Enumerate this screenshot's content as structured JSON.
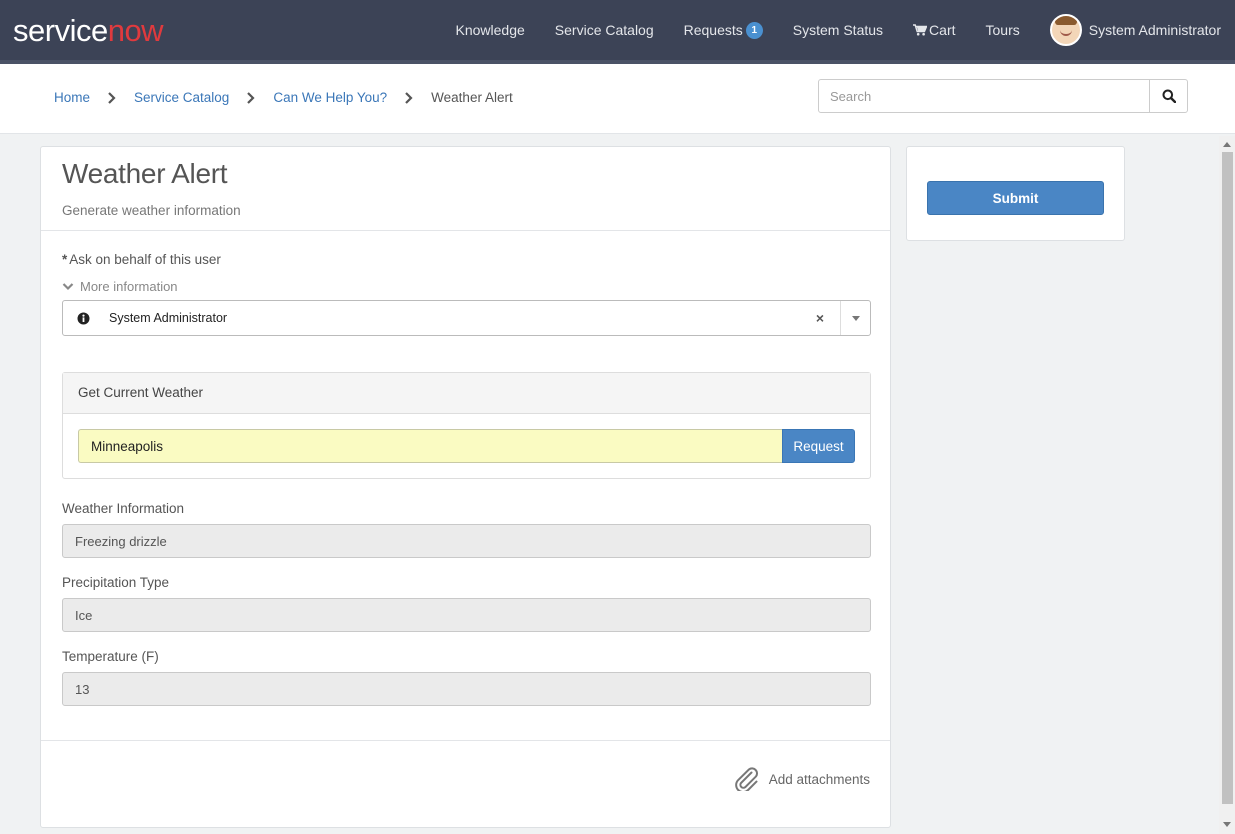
{
  "brand": {
    "logo_service": "service",
    "logo_now": "now"
  },
  "nav": {
    "knowledge": "Knowledge",
    "service_catalog": "Service Catalog",
    "requests": "Requests",
    "requests_badge": "1",
    "system_status": "System Status",
    "cart": "Cart",
    "tours": "Tours",
    "user_name": "System Administrator"
  },
  "breadcrumb": {
    "items": [
      "Home",
      "Service Catalog",
      "Can We Help You?",
      "Weather Alert"
    ]
  },
  "search": {
    "placeholder": "Search",
    "icon": "search-icon"
  },
  "form": {
    "title": "Weather Alert",
    "subtitle": "Generate weather information",
    "behalf_label": "Ask on behalf of this user",
    "required_marker": "*",
    "more_info": "More information",
    "behalf_value": "System Administrator",
    "clear": "×",
    "weather_section_title": "Get Current Weather",
    "city_value": "Minneapolis",
    "request_button": "Request",
    "weather_info_label": "Weather Information",
    "weather_info_value": "Freezing drizzle",
    "precip_label": "Precipitation Type",
    "precip_value": "Ice",
    "temp_label": "Temperature (F)",
    "temp_value": "13",
    "attachments": "Add attachments"
  },
  "side": {
    "submit": "Submit"
  },
  "colors": {
    "navbar": "#3c4356",
    "brand_now": "#e03a3e",
    "primary": "#4a86c5",
    "link": "#3b77b8",
    "highlight_input": "#fafbc2"
  }
}
